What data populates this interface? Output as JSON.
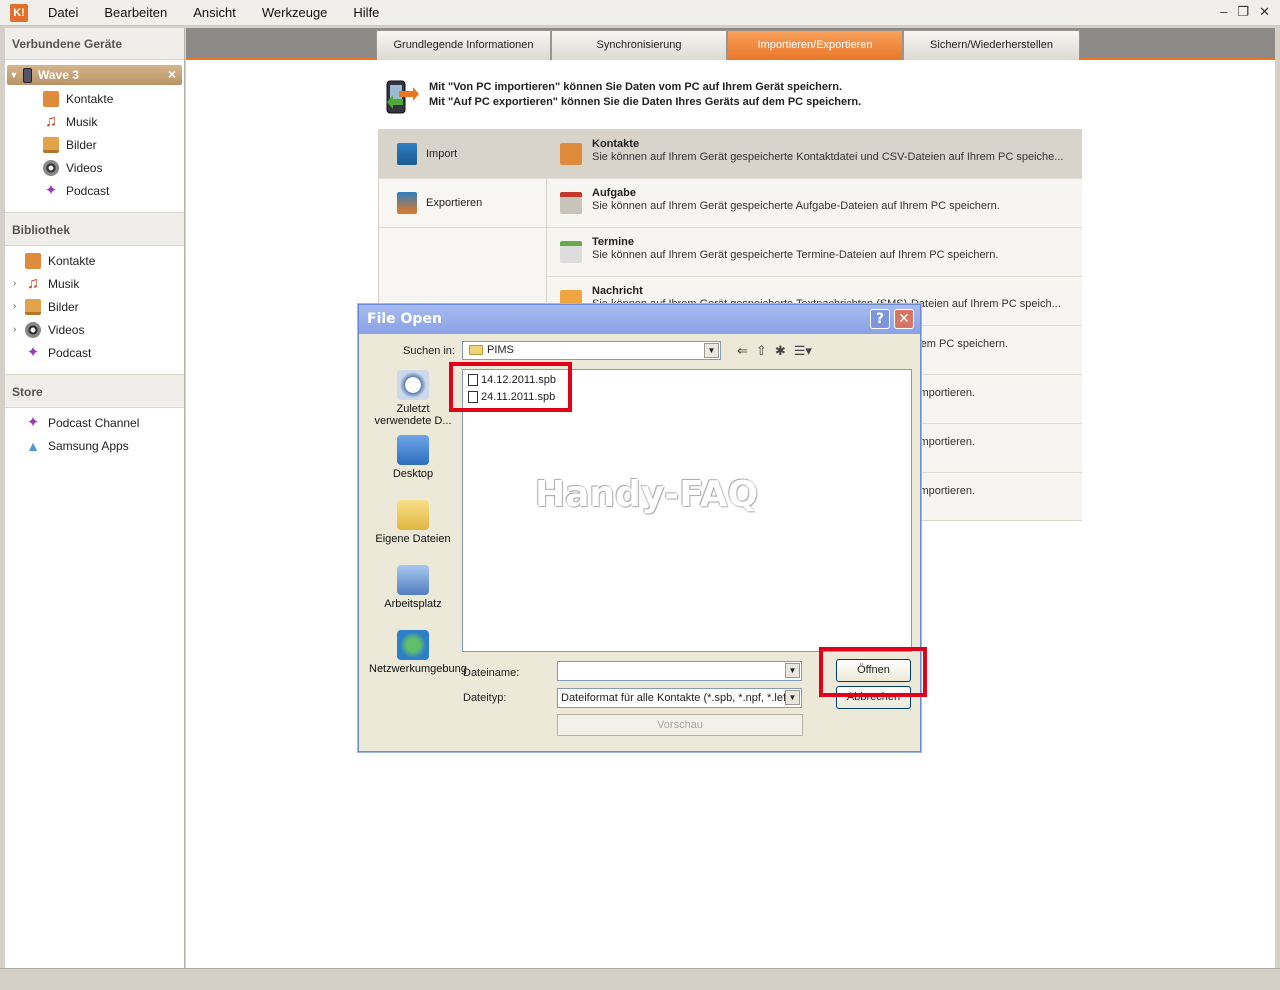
{
  "app": {
    "logo": "K!"
  },
  "menubar": {
    "items": [
      "Datei",
      "Bearbeiten",
      "Ansicht",
      "Werkzeuge",
      "Hilfe"
    ]
  },
  "window_controls": {
    "minimize": "–",
    "restore": "❐",
    "close": "✕"
  },
  "sidebar": {
    "devices_header": "Verbundene Geräte",
    "device": {
      "name": "Wave 3",
      "close": "×"
    },
    "device_items": [
      "Kontakte",
      "Musik",
      "Bilder",
      "Videos",
      "Podcast"
    ],
    "library_header": "Bibliothek",
    "library_items": [
      "Kontakte",
      "Musik",
      "Bilder",
      "Videos",
      "Podcast"
    ],
    "store_header": "Store",
    "store_items": [
      "Podcast Channel",
      "Samsung Apps"
    ]
  },
  "tabs": [
    "Grundlegende Informationen",
    "Synchronisierung",
    "Importieren/Exportieren",
    "Sichern/Wiederherstellen"
  ],
  "active_tab": "Importieren/Exportieren",
  "info": {
    "line1": "Mit \"Von PC importieren\" können Sie Daten vom PC auf Ihrem Gerät speichern.",
    "line2": "Mit \"Auf PC exportieren\" können Sie die Daten Ihres Geräts auf dem PC speichern."
  },
  "panel_left": [
    "Import",
    "Exportieren"
  ],
  "panel_right": [
    {
      "title": "Kontakte",
      "desc": "Sie können auf Ihrem Gerät gespeicherte Kontaktdatei und CSV-Dateien auf Ihrem PC speiche..."
    },
    {
      "title": "Aufgabe",
      "desc": "Sie können auf Ihrem Gerät gespeicherte Aufgabe-Dateien auf Ihrem PC speichern."
    },
    {
      "title": "Termine",
      "desc": "Sie können auf Ihrem Gerät gespeicherte Termine-Dateien auf Ihrem PC speichern."
    },
    {
      "title": "Nachricht",
      "desc": "Sie können auf Ihrem Gerät gespeicherte Textnachrichten (SMS)-Dateien auf Ihrem PC speich..."
    },
    {
      "title": "",
      "desc": "rem PC speichern."
    },
    {
      "title": "",
      "desc": "importieren."
    },
    {
      "title": "",
      "desc": "importieren."
    },
    {
      "title": "",
      "desc": "importieren."
    }
  ],
  "dialog": {
    "title": "File Open",
    "help": "?",
    "close": "✕",
    "lookin_label": "Suchen in:",
    "lookin_value": "PIMS",
    "toolbar_icons": [
      "back-icon",
      "up-folder-icon",
      "new-folder-icon",
      "view-menu-icon"
    ],
    "places": [
      "Zuletzt verwendete D...",
      "Desktop",
      "Eigene Dateien",
      "Arbeitsplatz",
      "Netzwerkumgebung"
    ],
    "files": [
      "14.12.2011.spb",
      "24.11.2011.spb"
    ],
    "watermark": "Handy-FAQ",
    "filename_label": "Dateiname:",
    "filename_value": "",
    "filetype_label": "Dateityp:",
    "filetype_value": "Dateiformat für alle Kontakte (*.spb, *.npf, *.lef,",
    "open_button": "Öffnen",
    "cancel_button": "Abbrechen",
    "preview_button": "Vorschau"
  },
  "colors": {
    "accent": "#e87722",
    "device_bg": "#c4a070",
    "highlight": "#e0001a",
    "dialog_title": "#8aa2e6"
  }
}
